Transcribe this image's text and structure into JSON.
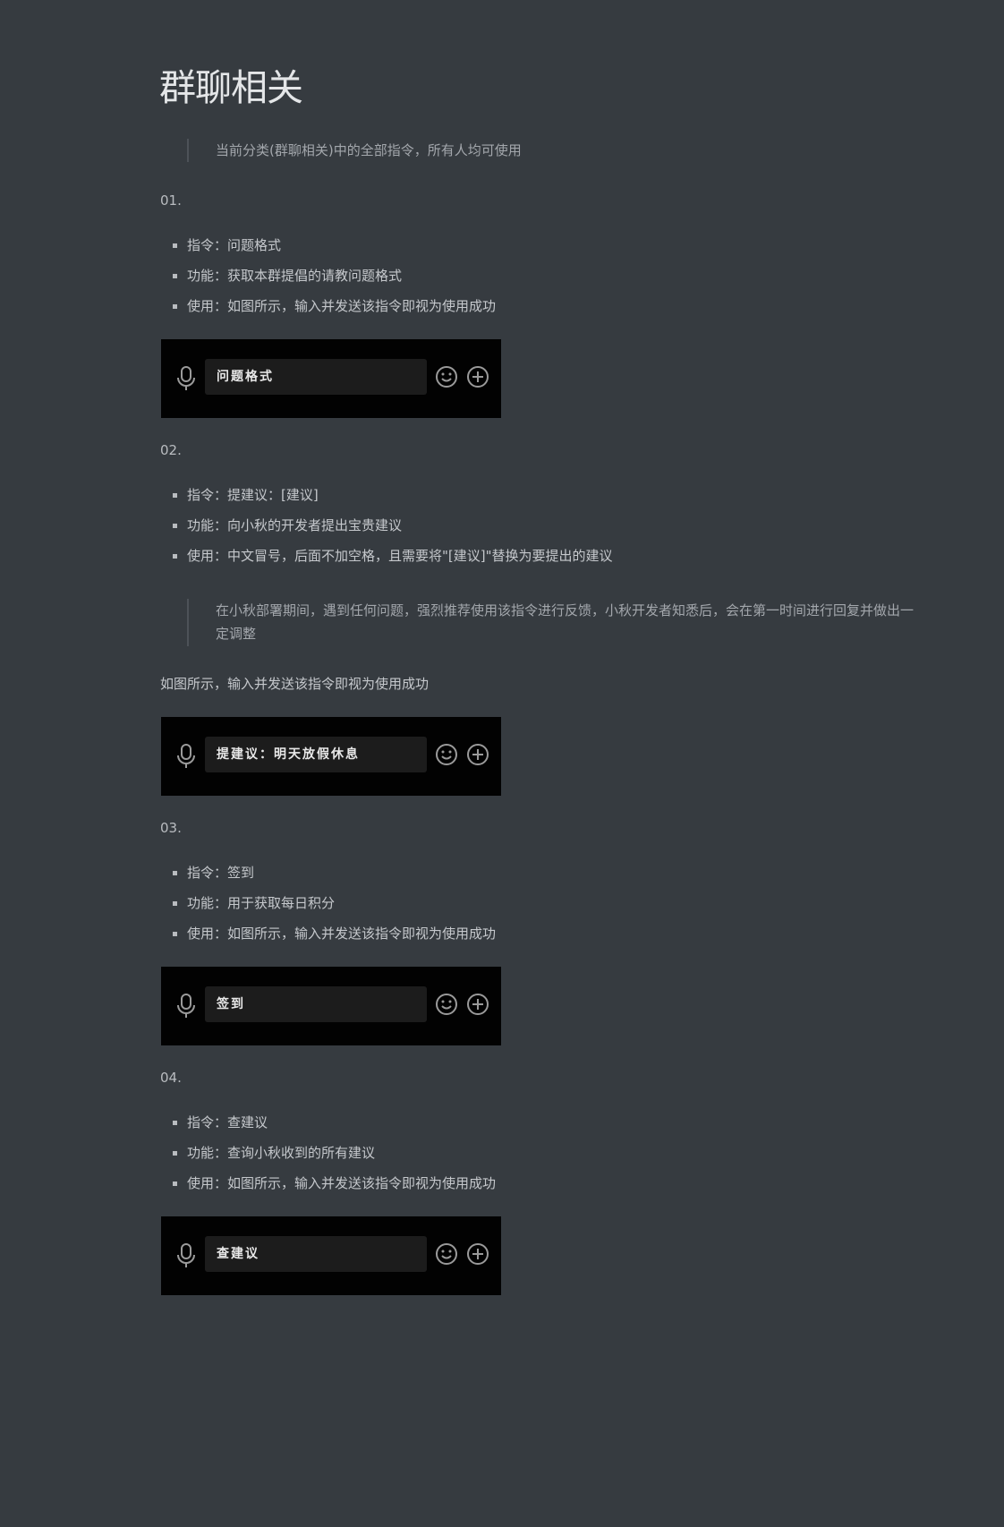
{
  "page_title": "群聊相关",
  "intro_quote": "当前分类(群聊相关)中的全部指令，所有人均可使用",
  "sections": [
    {
      "number": "01.",
      "items": [
        "指令：问题格式",
        "功能：获取本群提倡的请教问题格式",
        "使用：如图所示，输入并发送该指令即视为使用成功"
      ],
      "input_text": "问题格式"
    },
    {
      "number": "02.",
      "items": [
        "指令：提建议：[建议]",
        "功能：向小秋的开发者提出宝贵建议",
        "使用：中文冒号，后面不加空格，且需要将\"[建议]\"替换为要提出的建议"
      ],
      "note_quote": "在小秋部署期间，遇到任何问题，强烈推荐使用该指令进行反馈，小秋开发者知悉后，会在第一时间进行回复并做出一定调整",
      "paragraph": "如图所示，输入并发送该指令即视为使用成功",
      "input_text": "提建议：明天放假休息"
    },
    {
      "number": "03.",
      "items": [
        "指令：签到",
        "功能：用于获取每日积分",
        "使用：如图所示，输入并发送该指令即视为使用成功"
      ],
      "input_text": "签到"
    },
    {
      "number": "04.",
      "items": [
        "指令：查建议",
        "功能：查询小秋收到的所有建议",
        "使用：如图所示，输入并发送该指令即视为使用成功"
      ],
      "input_text": "查建议"
    }
  ],
  "icons": {
    "mic": "microphone-icon",
    "emoji": "smiley-icon",
    "plus": "plus-circle-icon"
  },
  "colors": {
    "background": "#363b40",
    "chat_bar": "#020202",
    "input_field": "#1c1c1c"
  }
}
